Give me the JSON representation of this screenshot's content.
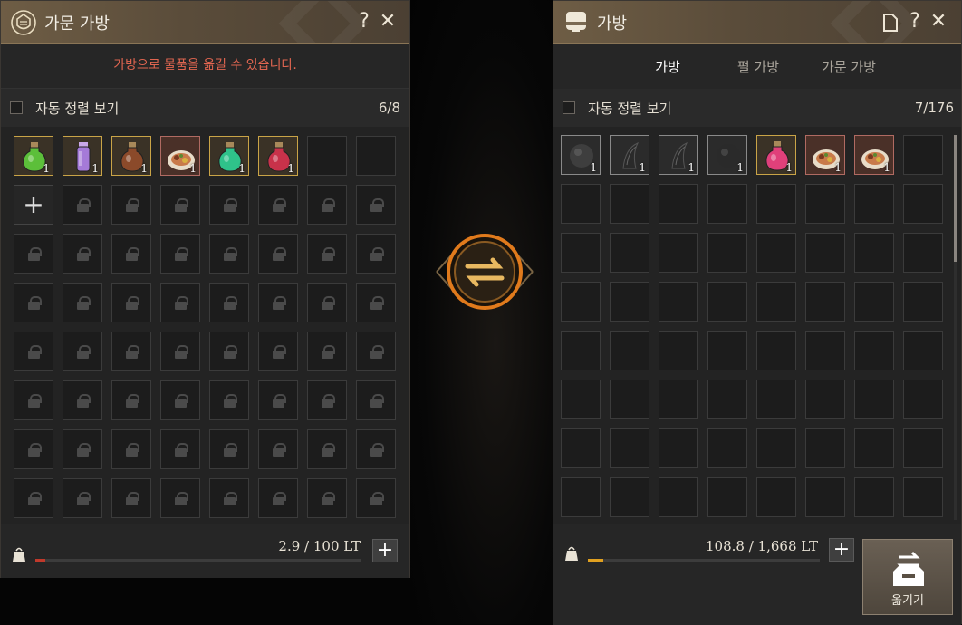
{
  "left_panel": {
    "title": "가문 가방",
    "help": "?",
    "close": "✕",
    "notice": "가방으로 물품을 옮길 수 있습니다.",
    "sort_label": "자동 정렬 보기",
    "count": "6/8",
    "items": [
      {
        "icon": "green-potion-icon",
        "qty": "1",
        "color": "#5cbf3a"
      },
      {
        "icon": "purple-vial-icon",
        "qty": "1",
        "color": "#a57ad8"
      },
      {
        "icon": "brown-potion-icon",
        "qty": "1",
        "color": "#8b4a2a"
      },
      {
        "icon": "meal-plate-icon",
        "qty": "1",
        "color": "#c87a4a"
      },
      {
        "icon": "teal-potion-icon",
        "qty": "1",
        "color": "#2fc28a"
      },
      {
        "icon": "red-potion-icon",
        "qty": "1",
        "color": "#c8324a"
      }
    ],
    "weight": "2.9 / 100 LT",
    "weight_fraction": 0.029,
    "bar_color": "#c0392b",
    "plus": "+"
  },
  "right_panel": {
    "title": "가방",
    "help": "?",
    "close": "✕",
    "tabs": [
      {
        "label": "가방",
        "active": true
      },
      {
        "label": "펄 가방",
        "active": false
      },
      {
        "label": "가문 가방",
        "active": false
      }
    ],
    "sort_label": "자동 정렬 보기",
    "count": "7/176",
    "items": [
      {
        "icon": "stone-orb-icon",
        "qty": "1",
        "kind": "gray"
      },
      {
        "icon": "dark-claw-icon",
        "qty": "1",
        "kind": "gray"
      },
      {
        "icon": "dark-claw-icon",
        "qty": "1",
        "kind": "gray"
      },
      {
        "icon": "dark-orb-icon",
        "qty": "1",
        "kind": "gray"
      },
      {
        "icon": "pink-potion-icon",
        "qty": "1",
        "kind": "gold"
      },
      {
        "icon": "meal-plate-icon",
        "qty": "1",
        "kind": "food"
      },
      {
        "icon": "meal-plate-icon",
        "qty": "1",
        "kind": "food"
      }
    ],
    "weight": "108.8 / 1,668 LT",
    "weight_fraction": 0.065,
    "bar_color": "#e0a020",
    "plus": "+",
    "move_label": "옮기기"
  },
  "accent": "#c9a447"
}
